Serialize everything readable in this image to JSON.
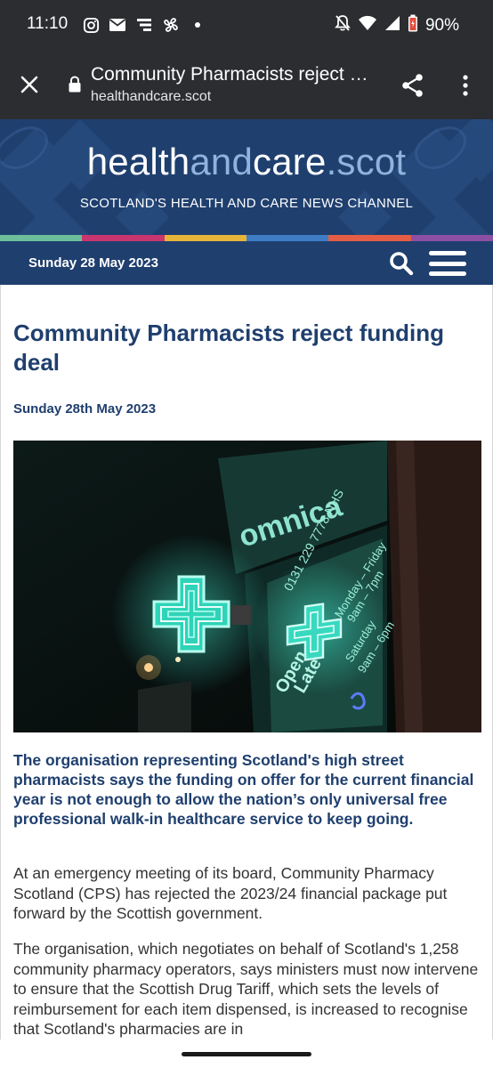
{
  "status_bar": {
    "time": "11:10",
    "battery": "90%",
    "left_icons": [
      "instagram-icon",
      "mail-icon",
      "notification-stack-icon",
      "fan-icon",
      "dot-icon"
    ],
    "right_icons": [
      "bell-off-icon",
      "wifi-icon",
      "signal-icon",
      "battery-icon"
    ]
  },
  "browser": {
    "page_title": "Community Pharmacists reject …",
    "url": "healthandcare.scot",
    "icons": [
      "close-icon",
      "lock-icon",
      "share-icon",
      "more-vert-icon"
    ]
  },
  "site": {
    "logo_part1": "health",
    "logo_part2": "and",
    "logo_part3": "care",
    "logo_part4": ".scot",
    "tagline": "SCOTLAND'S HEALTH AND CARE NEWS CHANNEL",
    "date": "Sunday 28 May 2023",
    "strip_colors": [
      "#6dbf9c",
      "#c9356e",
      "#e7b43a",
      "#3f7cc6",
      "#e45d44",
      "#8c4fa3"
    ],
    "brand_color": "#1f3f6e"
  },
  "article": {
    "title": "Community Pharmacists reject funding deal",
    "date": "Sunday 28th May 2023",
    "lead": "The organisation representing Scotland's high street pharmacists says the funding on offer for the current financial year is not enough to allow the nation’s only universal free professional walk-in healthcare service to keep going.",
    "paragraph1": "At an emergency meeting of its board, Community Pharmacy Scotland (CPS) has rejected the 2023/24 financial package put forward by the Scottish government.",
    "paragraph2": "The organisation, which negotiates on behalf of Scotland's 1,258 community pharmacy operators, says ministers must now intervene to ensure that the Scottish Drug Tariff, which sets the levels of reimbursement for each item dispensed, is increased to recognise that Scotland's pharmacies are in",
    "image_text": {
      "sign": "omnica",
      "phone": "0131 229 7778 NHS",
      "hours1": "Monday – Friday",
      "hours2": "9am – 7pm",
      "hours3": "Saturday",
      "hours4": "9am – 6pm",
      "open1": "Open",
      "open2": "Late"
    }
  }
}
